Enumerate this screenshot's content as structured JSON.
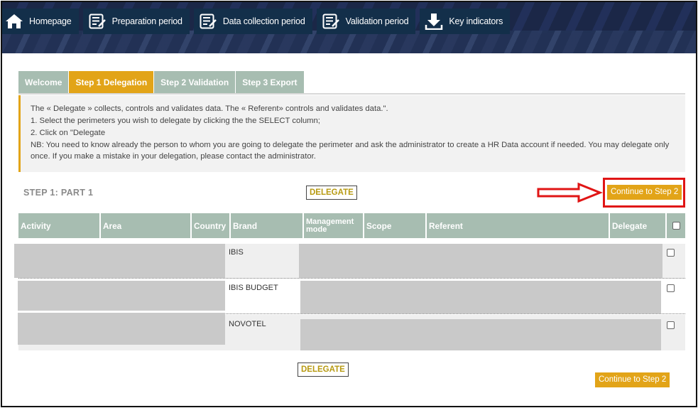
{
  "nav": [
    {
      "label": "Homepage",
      "icon": "home-icon"
    },
    {
      "label": "Preparation period",
      "icon": "checklist-icon"
    },
    {
      "label": "Data collection period",
      "icon": "checklist-icon"
    },
    {
      "label": "Validation period",
      "icon": "checklist-icon"
    },
    {
      "label": "Key indicators",
      "icon": "download-icon"
    }
  ],
  "tabs": [
    {
      "label": "Welcome",
      "active": false
    },
    {
      "label": "Step 1 Delegation",
      "active": true
    },
    {
      "label": "Step 2 Validation",
      "active": false
    },
    {
      "label": "Step 3 Export",
      "active": false
    }
  ],
  "info": {
    "line1": "The « Delegate » collects, controls and validates data. The « Referent» controls and validates data.\".",
    "line2": "1. Select the perimeters you wish to delegate by clicking the the SELECT column;",
    "line3": "2. Click on \"Delegate",
    "line4": "NB: You need to know already the person to whom you are going to delegate the perimeter and ask the administrator to create a HR Data account if needed. You may delegate only once. If you make a mistake in your delegation, please contact the administrator."
  },
  "step_title": "STEP 1: PART 1",
  "delegate_label": "DELEGATE",
  "continue_label": "Continue to Step 2",
  "table": {
    "columns": [
      "Activity",
      "Area",
      "Country",
      "Brand",
      "Management mode",
      "Scope",
      "Referent",
      "Delegate"
    ],
    "rows": [
      {
        "brand": "IBIS"
      },
      {
        "brand": "IBIS BUDGET"
      },
      {
        "brand": "NOVOTEL"
      }
    ]
  },
  "colors": {
    "accent": "#e2a418",
    "tab_inactive": "#a7bdb1",
    "nav_bg": "#132f4a",
    "highlight": "#e01515"
  }
}
